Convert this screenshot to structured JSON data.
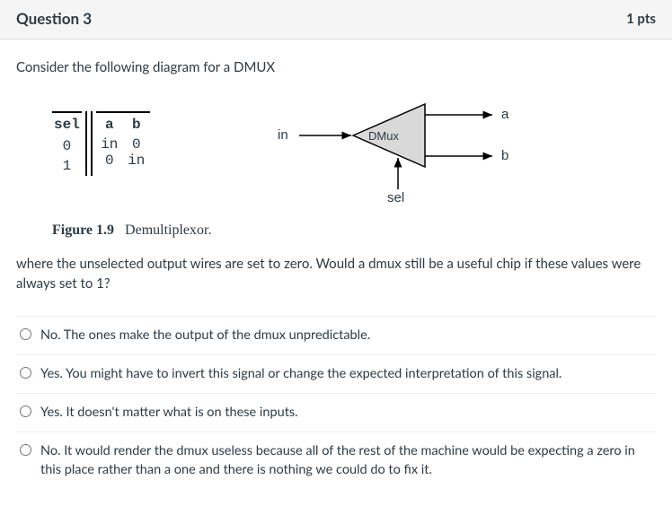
{
  "header": {
    "title": "Question 3",
    "points": "1 pts"
  },
  "intro": "Consider the following diagram for a DMUX",
  "truth_table": {
    "sel_header": "sel",
    "a_header": "a",
    "b_header": "b",
    "rows": [
      {
        "sel": "0",
        "a": "in",
        "b": "0"
      },
      {
        "sel": "1",
        "a": "0",
        "b": "in"
      }
    ]
  },
  "dmux": {
    "in_label": "in",
    "a_label": "a",
    "b_label": "b",
    "sel_label": "sel",
    "chip_label": "DMux"
  },
  "caption": {
    "fig": "Figure 1.9",
    "text": "Demultiplexor."
  },
  "tail": "where the unselected output wires are set to zero. Would a dmux still be a useful chip if these values were always set to 1?",
  "answers": [
    "No. The ones make the output of the dmux unpredictable.",
    "Yes. You might have to invert this signal or change the expected interpretation of this signal.",
    "Yes. It doesn't matter what is on these inputs.",
    "No. It would render the dmux useless because all of the rest of the machine would be expecting a zero in this place rather than a one and there is nothing we could do to fix it."
  ]
}
